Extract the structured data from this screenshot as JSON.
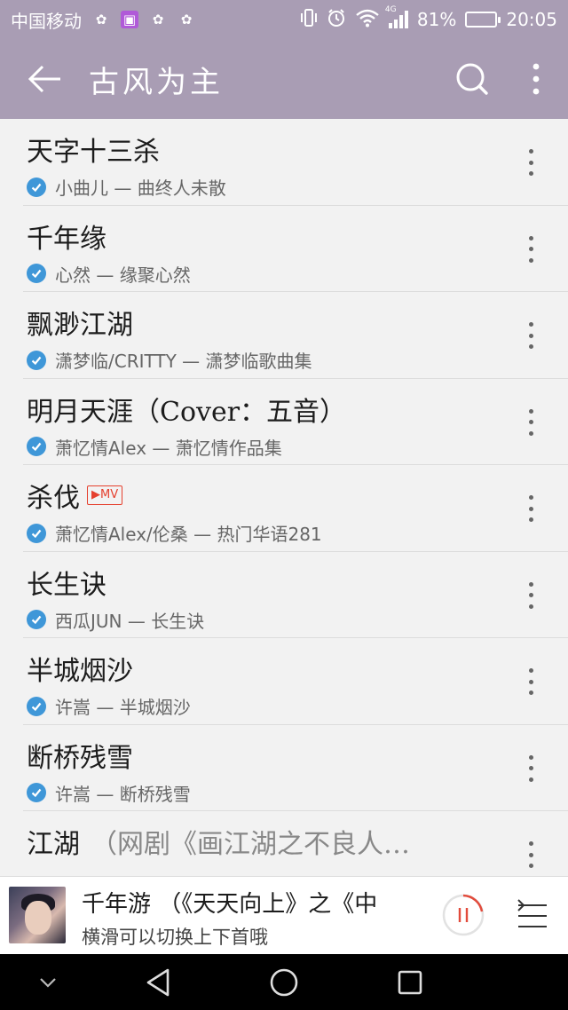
{
  "status_bar": {
    "carrier": "中国移动",
    "network": "4G",
    "battery": "81%",
    "battery_level": 0.81,
    "time": "20:05"
  },
  "app_bar": {
    "title": "古风为主"
  },
  "songs": [
    {
      "title": "天字十三杀",
      "subtitle": "小曲儿 — 曲终人未散",
      "mv": false
    },
    {
      "title": "千年缘",
      "subtitle": "心然 — 缘聚心然",
      "mv": false
    },
    {
      "title": "飘渺江湖",
      "subtitle": "潇梦临/CRITTY — 潇梦临歌曲集",
      "mv": false
    },
    {
      "title": "明月天涯（Cover：五音）",
      "subtitle": "萧忆情Alex — 萧忆情作品集",
      "mv": false
    },
    {
      "title": "杀伐",
      "mv_label": "▶MV",
      "subtitle": "萧忆情Alex/伦桑 —  热门华语281",
      "mv": true
    },
    {
      "title": "长生诀",
      "subtitle": "西瓜JUN — 长生诀",
      "mv": false
    },
    {
      "title": "半城烟沙",
      "subtitle": "许嵩 — 半城烟沙",
      "mv": false
    },
    {
      "title": "断桥残雪",
      "subtitle": "许嵩 — 断桥残雪",
      "mv": false
    },
    {
      "title": "江湖",
      "title_tail": "（网剧《画江湖之不良人…",
      "subtitle": "",
      "mv": false
    }
  ],
  "now_playing": {
    "song": "千年游 （《天天向上》之《中",
    "hint": "横滑可以切换上下首哦"
  },
  "colors": {
    "header_bg": "#a99db4",
    "check_blue": "#3f97d8",
    "mv_red": "#e5402e",
    "pause_red": "#e24b3c"
  }
}
